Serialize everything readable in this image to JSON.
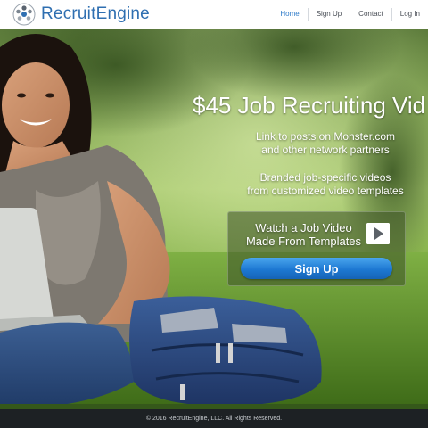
{
  "brand": {
    "name": "RecruitEngine",
    "logo_icon": "people-cluster-icon",
    "color": "#2f6fb1"
  },
  "nav": {
    "items": [
      {
        "label": "Home",
        "active": true
      },
      {
        "label": "Sign Up",
        "active": false
      },
      {
        "label": "Contact",
        "active": false
      },
      {
        "label": "Log In",
        "active": false
      }
    ]
  },
  "hero": {
    "title": "$45 Job Recruiting Vid",
    "features": [
      {
        "line1": "Link to posts on Monster.com",
        "line2": "and other network partners"
      },
      {
        "line1": "Branded job-specific videos",
        "line2": "from customized video templates"
      }
    ],
    "cta": {
      "video_line1": "Watch a Job Video",
      "video_line2": "Made From Templates",
      "play_icon": "play-icon",
      "signup_label": "Sign Up"
    }
  },
  "footer": {
    "copyright": "© 2016 RecruitEngine, LLC. All Rights Reserved."
  },
  "colors": {
    "accent": "#2f7bc9",
    "button": "#1d78d2",
    "footer_bg": "#1d2124"
  }
}
